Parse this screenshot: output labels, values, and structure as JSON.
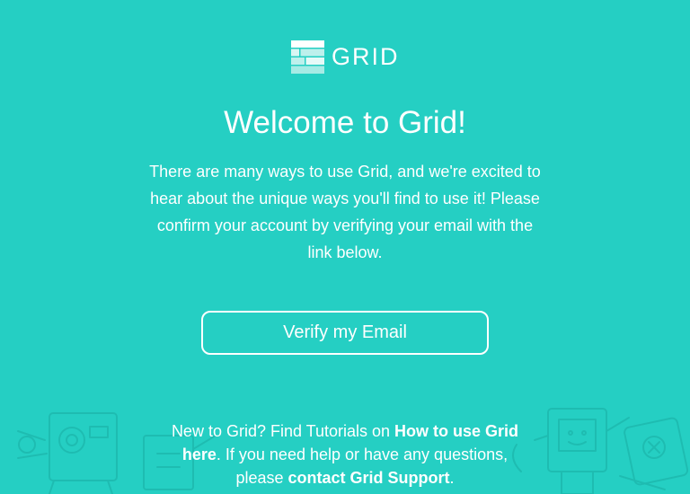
{
  "brand": {
    "name": "GRID",
    "logo_icon": "grid-logo-icon"
  },
  "colors": {
    "background": "#25cfc3",
    "text": "#ffffff"
  },
  "main": {
    "title": "Welcome to Grid!",
    "intro": "There are many ways to use Grid, and we're excited to hear about the unique ways you'll find to use it! Please confirm your account by verifying your email with the link below.",
    "verify_button": "Verify my Email"
  },
  "footer": {
    "part1": "New to Grid? Find Tutorials on ",
    "tutorial_link": "How to use Grid here",
    "part2": ". If you need help or have any questions, please ",
    "support_link": "contact Grid Support",
    "part3": "."
  }
}
